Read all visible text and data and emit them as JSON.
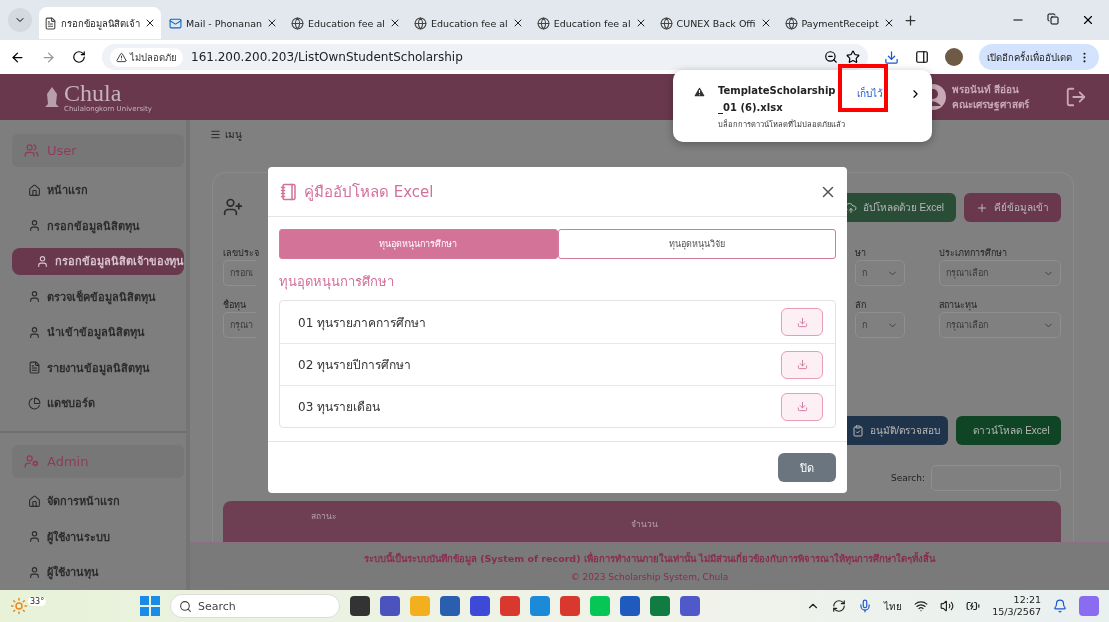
{
  "browser": {
    "tabs": [
      {
        "title": "กรอกข้อมูลนิสิตเจ้า",
        "selected": true
      },
      {
        "title": "Mail - Phonanan",
        "selected": false
      },
      {
        "title": "Education fee al",
        "selected": false
      },
      {
        "title": "Education fee al",
        "selected": false
      },
      {
        "title": "Education fee al",
        "selected": false
      },
      {
        "title": "CUNEX Back Offi",
        "selected": false
      },
      {
        "title": "PaymentReceipt",
        "selected": false
      }
    ],
    "security_label": "ไม่ปลอดภัย",
    "url": "161.200.200.203/ListOwnStudentScholarship",
    "update_button": "เปิดอีกครั้งเพื่ออัปเดต"
  },
  "download_popup": {
    "filename": "TemplateScholarship_01 (6).xlsx",
    "action": "เก็บไว้",
    "message": "บล็อกการดาวน์โหลดที่ไม่ปลอดภัยแล้ว"
  },
  "header": {
    "logo": "Chula",
    "logo_sub": "Chulalongkorn University",
    "user_name": "พรอนันท์ สีอ่อน",
    "user_faculty": "คณะเศรษฐศาสตร์"
  },
  "sidebar": {
    "sections": [
      {
        "title": "User",
        "items": [
          {
            "label": "หน้าแรก",
            "selected": false
          },
          {
            "label": "กรอกข้อมูลนิสิตทุน",
            "selected": false
          },
          {
            "label": "กรอกข้อมูลนิสิตเจ้าของทุน",
            "selected": true
          },
          {
            "label": "ตรวจเช็คข้อมูลนิสิตทุน",
            "selected": false
          },
          {
            "label": "นำเข้าข้อมูลนิสิตทุน",
            "selected": false
          },
          {
            "label": "รายงานข้อมูลนิสิตทุน",
            "selected": false
          },
          {
            "label": "แดชบอร์ด",
            "selected": false
          }
        ]
      },
      {
        "title": "Admin",
        "items": [
          {
            "label": "จัดการหน้าแรก",
            "selected": false
          },
          {
            "label": "ผู้ใช้งานระบบ",
            "selected": false
          },
          {
            "label": "ผู้ใช้งานทุน",
            "selected": false
          }
        ]
      }
    ]
  },
  "menu_label": "เมนู",
  "page": {
    "top_buttons": [
      {
        "label": "อัปโหลดด้วย Excel",
        "kind": "upload"
      },
      {
        "label": "คีย์ข้อมูลเข้า",
        "kind": "add"
      }
    ],
    "filters_left": [
      {
        "label": "เลขประจ",
        "placeholder": "กรอกเ"
      },
      {
        "label": "ชื่อทุน",
        "placeholder": "กรุณา"
      }
    ],
    "filters_right": [
      {
        "label": "ษา",
        "placeholder": "ก",
        "kind": "select"
      },
      {
        "label": "ประเภทการศึกษา",
        "placeholder": "กรุณาเลือก",
        "kind": "select"
      },
      {
        "label": "ลัก",
        "placeholder": "ก",
        "kind": "select"
      },
      {
        "label": "สถานะทุน",
        "placeholder": "กรุณาเลือก",
        "kind": "select"
      }
    ],
    "action_buttons": [
      {
        "label": "อนุมัติ/ตรวจสอบ",
        "kind": "approve"
      },
      {
        "label": "ดาวน์โหลด Excel",
        "kind": "download"
      }
    ],
    "search_label": "Search:",
    "table_headers": [
      "สถานะ",
      "จำนวน"
    ]
  },
  "modal": {
    "title": "คู่มืออัปโหลด Excel",
    "tabs": [
      {
        "label": "ทุนอุดหนุนการศึกษา",
        "selected": true
      },
      {
        "label": "ทุนอุดหนุนวิจัย",
        "selected": false
      }
    ],
    "section_title": "ทุนอุดหนุนการศึกษา",
    "templates": [
      "01 ทุนรายภาคการศึกษา",
      "02 ทุนรายปีการศึกษา",
      "03 ทุนรายเดือน"
    ],
    "close_button": "ปิด"
  },
  "footer": {
    "notice": "ระบบนี้เป็นระบบบันทึกข้อมูล (System of record) เพื่อการทำงานภายในเท่านั้น ไม่มีส่วนเกี่ยวข้องกับการพิจารณาให้ทุนการศึกษาใดๆทั้งสิ้น",
    "copyright": "© 2023 Scholarship System, Chula"
  },
  "taskbar": {
    "weather": "33°",
    "search": "Search",
    "language": "ไทย",
    "time": "12:21",
    "date": "15/3/2567"
  }
}
